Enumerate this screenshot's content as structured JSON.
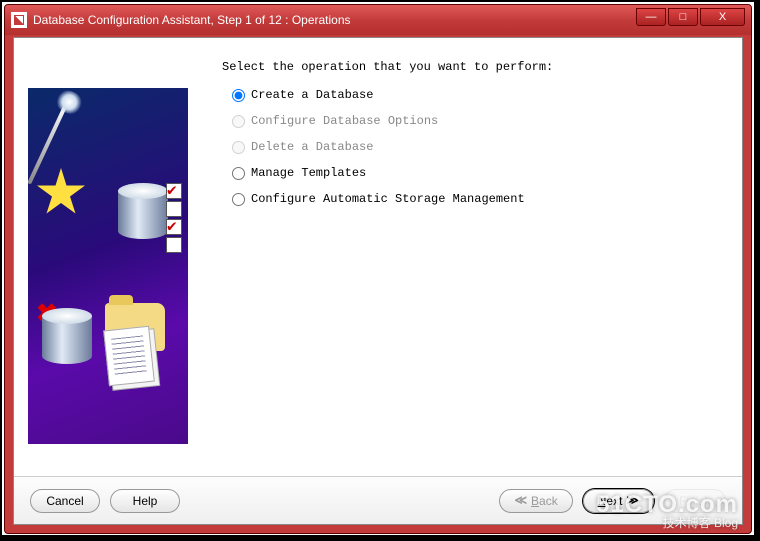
{
  "window": {
    "title": "Database Configuration Assistant, Step 1 of 12 : Operations"
  },
  "win_controls": {
    "minimize": "—",
    "maximize": "□",
    "close": "X"
  },
  "main": {
    "prompt": "Select the operation that you want to perform:",
    "options": [
      {
        "label": "Create a Database",
        "enabled": true,
        "selected": true
      },
      {
        "label": "Configure Database Options",
        "enabled": false,
        "selected": false
      },
      {
        "label": "Delete a Database",
        "enabled": false,
        "selected": false
      },
      {
        "label": "Manage Templates",
        "enabled": true,
        "selected": false
      },
      {
        "label": "Configure Automatic Storage Management",
        "enabled": true,
        "selected": false
      }
    ]
  },
  "footer": {
    "cancel": "Cancel",
    "help": "Help",
    "back": "Back",
    "next": "Next",
    "finish": "Finish",
    "arrow_left": "≪",
    "arrow_right": "≫"
  },
  "watermark": {
    "line1": "51CTO.com",
    "line2": "技术博客  Blog"
  }
}
